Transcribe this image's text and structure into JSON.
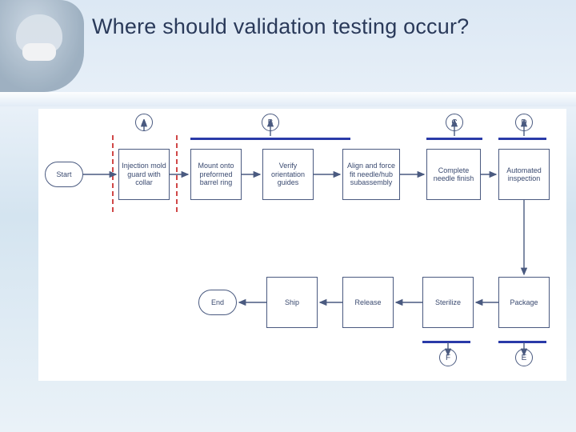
{
  "title": "Where should validation testing occur?",
  "labels": {
    "a": "A",
    "b": "B",
    "c": "C",
    "d": "D",
    "e": "E",
    "f": "F"
  },
  "nodes": {
    "start": "Start",
    "inj_mold": "Injection mold guard with collar",
    "mount": "Mount onto preformed barrel ring",
    "verify": "Verify orientation guides",
    "align": "Align and force fit needle/hub subassembly",
    "complete": "Complete needle finish",
    "auto_insp": "Automated inspection",
    "package": "Package",
    "sterilize": "Sterilize",
    "release": "Release",
    "ship": "Ship",
    "end": "End"
  }
}
